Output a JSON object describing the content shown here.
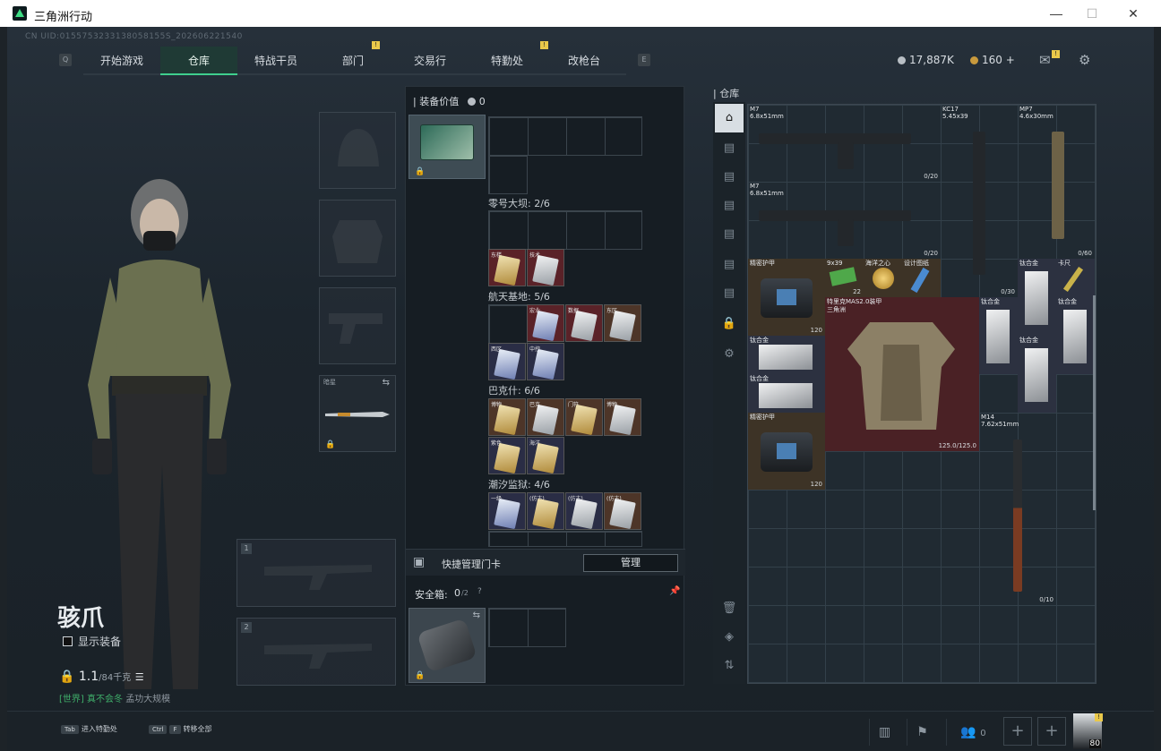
{
  "window": {
    "title": "三角洲行动",
    "controls": [
      "—",
      "☐",
      "✕"
    ]
  },
  "uid": "CN UID:0155753233138058155S_202606221540",
  "nav": {
    "left_key": "Q",
    "right_key": "E",
    "tabs": [
      "开始游戏",
      "仓库",
      "特战干员",
      "部门",
      "交易行",
      "特勤处",
      "改枪台"
    ],
    "active": "仓库",
    "badge": "!"
  },
  "currency": {
    "silver": "17,887K",
    "gold": "160 +"
  },
  "character": {
    "name": "骇爪",
    "show_gear_label": "显示装备",
    "level": "1.1",
    "level_sub": "/84千克",
    "chat_channel": "[世界]",
    "chat_text": "真不会冬",
    "chat_text2": "孟功大规模"
  },
  "equipment": {
    "knife_label": "暗星",
    "primary_num": "1",
    "secondary_num": "2"
  },
  "middle": {
    "header": "装备价值",
    "value": "0",
    "sections": [
      {
        "label": "零号大坝: 2/6"
      },
      {
        "label": "航天基地: 5/6"
      },
      {
        "label": "巴克什: 6/6"
      },
      {
        "label": "潮汐监狱: 4/6"
      }
    ],
    "cards": {
      "s2": [
        "东楼",
        "技术"
      ],
      "s3": [
        "宏业",
        "数据",
        "东区",
        "西区",
        "中控"
      ],
      "s4": [
        "博物",
        "巴克",
        "门符",
        "博物",
        "紫色",
        "海洋"
      ],
      "s5": [
        "一级",
        "(仿古)",
        "(仿古)",
        "(仿古)"
      ]
    },
    "quick_manage": "快捷管理门卡",
    "manage_btn": "管理",
    "safe_label": "安全箱:",
    "safe_value": "0",
    "safe_max": "/2"
  },
  "warehouse": {
    "label": "仓库",
    "items": [
      {
        "name": "M7",
        "sub": "6.8x51mm",
        "count": "0/20"
      },
      {
        "name": "M7",
        "sub": "6.8x51mm",
        "count": "0/20"
      },
      {
        "name": "KC17",
        "sub": "5.45x39",
        "count": "0/30"
      },
      {
        "name": "MP7",
        "sub": "4.6x30mm",
        "count": "0/60"
      },
      {
        "name": "精密护甲",
        "sub": "",
        "count": "120"
      },
      {
        "name": "9x39",
        "sub": "",
        "count": "22"
      },
      {
        "name": "海洋之心",
        "sub": "",
        "count": ""
      },
      {
        "name": "设计图纸",
        "sub": "",
        "count": ""
      },
      {
        "name": "特里克MAS2.0装甲",
        "sub": "三角洲",
        "count": "125.0/125.0"
      },
      {
        "name": "钛合金",
        "sub": "",
        "count": ""
      },
      {
        "name": "卡尺",
        "sub": "",
        "count": ""
      },
      {
        "name": "精密护甲",
        "sub": "",
        "count": "120"
      },
      {
        "name": "M14",
        "sub": "7.62x51mm",
        "count": "0/10"
      }
    ]
  },
  "bottom": {
    "hint1_key": "Tab",
    "hint1": "进入特勤处",
    "hint2_key1": "Ctrl",
    "hint2_key2": "F",
    "hint2": "转移全部",
    "friends": "0",
    "avatar_level": "80"
  },
  "colors": {
    "accent": "#3fcf8e",
    "badge": "#e9c84a"
  }
}
